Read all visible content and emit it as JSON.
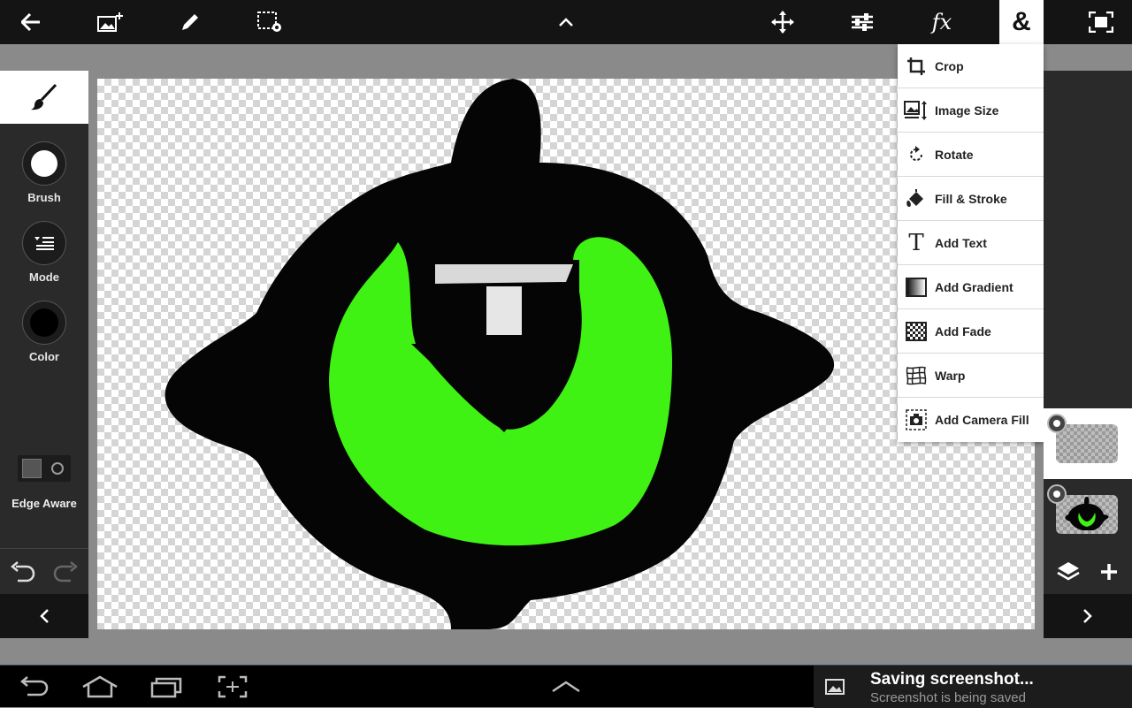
{
  "app": {
    "toolbar_icons": [
      "back-arrow-icon",
      "add-image-icon",
      "pencil-icon",
      "selection-settings-icon",
      "chevron-up-icon",
      "move-icon",
      "adjustments-icon",
      "fx-icon",
      "ampersand-icon",
      "fullscreen-icon"
    ],
    "fx_label": "fx",
    "ampersand_label": "&"
  },
  "left_panel": {
    "tools": [
      {
        "label": "Brush",
        "icon": "white-circle-icon"
      },
      {
        "label": "Mode",
        "icon": "mode-list-icon"
      },
      {
        "label": "Color",
        "icon": "black-circle-icon"
      }
    ],
    "edge_aware_label": "Edge Aware"
  },
  "menu": {
    "items": [
      {
        "label": "Crop",
        "icon": "crop-icon"
      },
      {
        "label": "Image Size",
        "icon": "image-size-icon"
      },
      {
        "label": "Rotate",
        "icon": "rotate-icon"
      },
      {
        "label": "Fill & Stroke",
        "icon": "fill-bucket-icon"
      },
      {
        "label": "Add Text",
        "icon": "text-icon"
      },
      {
        "label": "Add Gradient",
        "icon": "gradient-icon"
      },
      {
        "label": "Add Fade",
        "icon": "fade-icon"
      },
      {
        "label": "Warp",
        "icon": "warp-icon"
      },
      {
        "label": "Add Camera Fill",
        "icon": "camera-fill-icon"
      }
    ]
  },
  "layers": {
    "count": 2,
    "selected_index": 0
  },
  "canvas": {
    "artwork_colors": {
      "outline": "#000000",
      "fill": "#3ff214"
    }
  },
  "notification": {
    "title": "Saving screenshot...",
    "subtitle": "Screenshot is being saved"
  },
  "colors": {
    "toolbar_bg": "#141414",
    "panel_bg": "#2a2a2a",
    "accent_green": "#3ff214"
  }
}
